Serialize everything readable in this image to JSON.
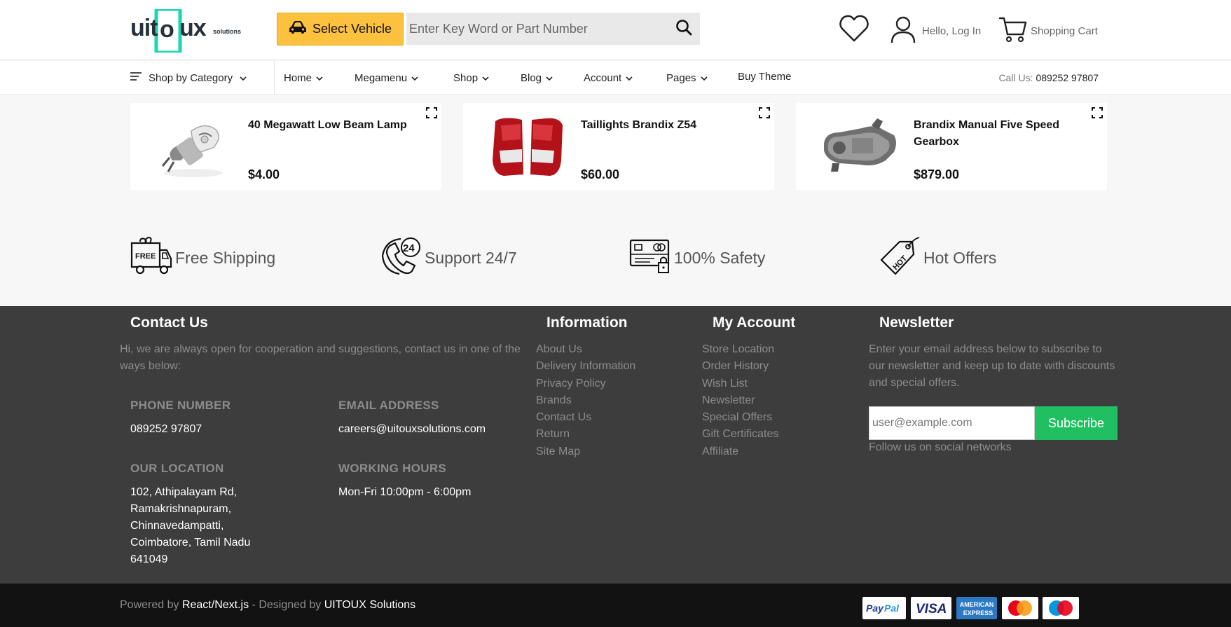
{
  "header": {
    "logo_text": "uitoux",
    "logo_sub": "solutions",
    "select_vehicle_label": "Select Vehicle",
    "search_placeholder": "Enter Key Word or Part Number",
    "account_label": "Hello, Log In",
    "cart_label": "Shopping Cart"
  },
  "nav": {
    "category_label": "Shop by Category",
    "items": [
      {
        "label": "Home"
      },
      {
        "label": "Megamenu"
      },
      {
        "label": "Shop"
      },
      {
        "label": "Blog"
      },
      {
        "label": "Account"
      },
      {
        "label": "Pages"
      },
      {
        "label": "Buy Theme"
      }
    ],
    "call_label": "Call Us:",
    "call_number": "089252 97807"
  },
  "products": [
    {
      "name": "40 Megawatt Low Beam Lamp",
      "price": "$4.00",
      "icon": "lamp-bulb-image"
    },
    {
      "name": "Taillights Brandix Z54",
      "price": "$60.00",
      "icon": "taillights-image"
    },
    {
      "name": "Brandix Manual Five Speed Gearbox",
      "price": "$879.00",
      "icon": "gearbox-image"
    }
  ],
  "features": [
    {
      "label": "Free Shipping",
      "icon": "free-shipping-truck-icon",
      "badge": "FREE"
    },
    {
      "label": "Support 24/7",
      "icon": "support-24-phone-icon",
      "badge": "24"
    },
    {
      "label": "100% Safety",
      "icon": "safety-card-lock-icon"
    },
    {
      "label": "Hot Offers",
      "icon": "hot-tag-icon",
      "badge": "HOT"
    }
  ],
  "footer": {
    "contact": {
      "title": "Contact Us",
      "description": "Hi, we are always open for cooperation and suggestions, contact us in one of the ways below:",
      "phone_label": "PHONE NUMBER",
      "phone": "089252 97807",
      "email_label": "EMAIL ADDRESS",
      "email": "careers@uitouxsolutions.com",
      "location_label": "OUR LOCATION",
      "location": [
        "102, Athipalayam Rd,",
        "Ramakrishnapuram,",
        "Chinnavedampatti,",
        "Coimbatore, Tamil Nadu",
        "641049"
      ],
      "hours_label": "WORKING HOURS",
      "hours": "Mon-Fri 10:00pm - 6:00pm"
    },
    "information": {
      "title": "Information",
      "links": [
        "About Us",
        "Delivery Information",
        "Privacy Policy",
        "Brands",
        "Contact Us",
        "Return",
        "Site Map"
      ]
    },
    "my_account": {
      "title": "My Account",
      "links": [
        "Store Location",
        "Order History",
        "Wish List",
        "Newsletter",
        "Special Offers",
        "Gift Certificates",
        "Affiliate"
      ]
    },
    "newsletter": {
      "title": "Newsletter",
      "description": "Enter your email address below to subscribe to our newsletter and keep up to date with discounts and special offers.",
      "placeholder": "user@example.com",
      "button_label": "Subscribe",
      "social_label": "Follow us on social networks"
    }
  },
  "bottom": {
    "powered_prefix": "Powered by",
    "powered_tech": "React/Next.js",
    "designed_prefix": "- Designed by",
    "designer": "UITOUX Solutions",
    "payments": [
      {
        "name": "PayPal"
      },
      {
        "name": "VISA"
      },
      {
        "name": "AMERICAN EXPRESS"
      },
      {
        "name": "Mastercard"
      },
      {
        "name": "Maestro"
      }
    ]
  },
  "colors": {
    "select_vehicle_bg": "#fcc13e",
    "subscribe_bg": "#1fbf62",
    "logo_accent": "#1ad6b4",
    "footer_bg": "#3d3d3d",
    "bottom_bg": "#121212"
  }
}
